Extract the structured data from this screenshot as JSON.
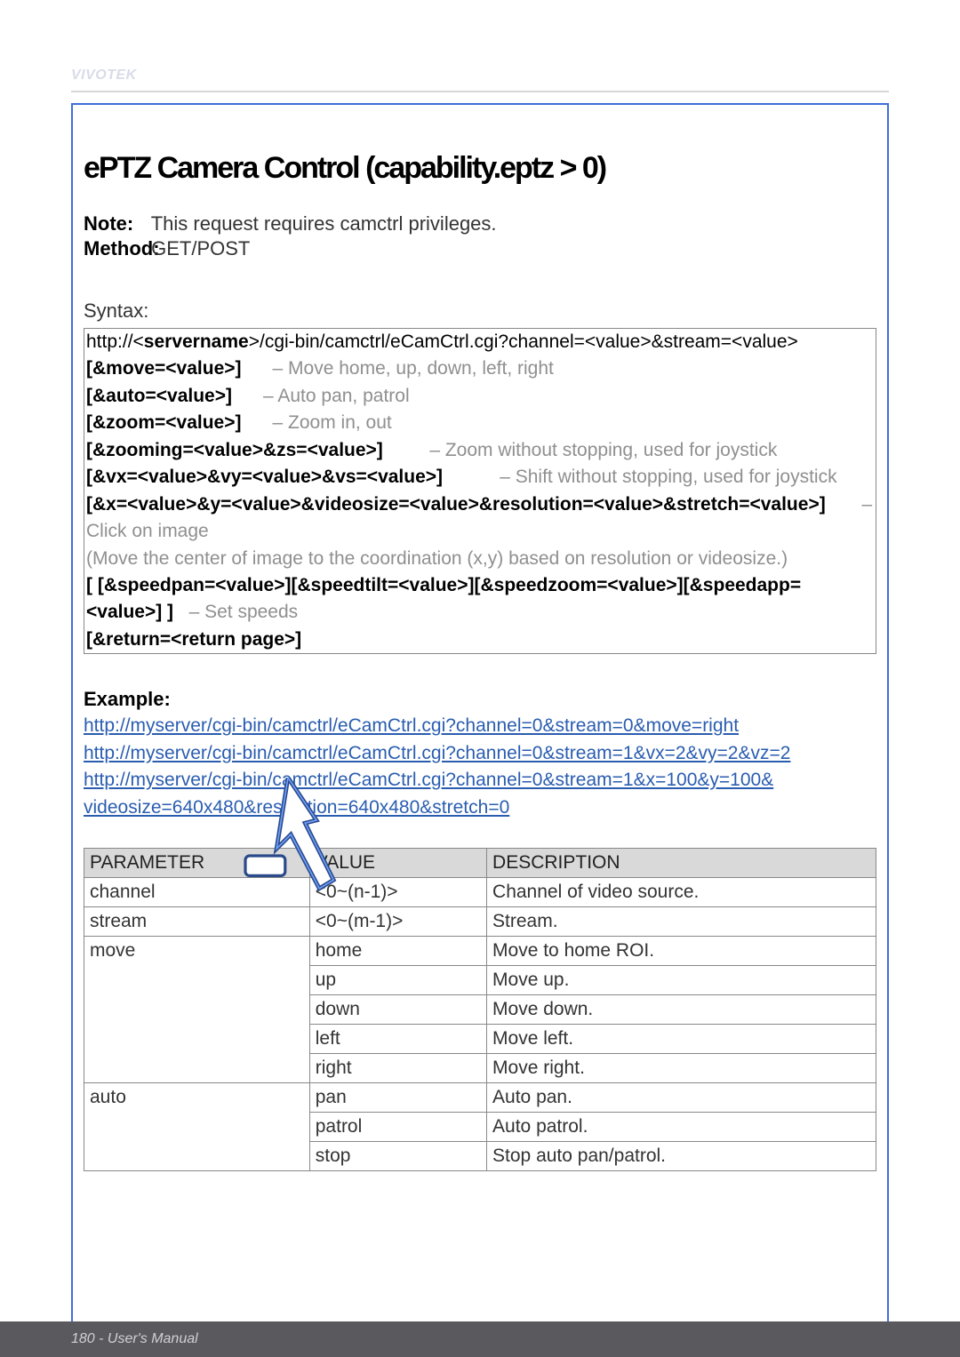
{
  "header": {
    "brand": "VIVOTEK"
  },
  "section": {
    "title": "ePTZ Camera Control (capability.eptz > 0)",
    "note_label": "Note:",
    "note_text": "This request requires camctrl privileges.",
    "method_label": "Method:",
    "method_text": "GET/POST"
  },
  "syntax": {
    "label": "Syntax:",
    "line_url_prefix": "http://<",
    "line_url_server": "servername",
    "line_url_rest": ">/cgi-bin/camctrl/eCamCtrl.cgi?channel=<value>&stream=<value>",
    "move_opt": "[&move=<value>]",
    "move_desc": "– Move home, up, down, left, right",
    "auto_opt": "[&auto=<value>]",
    "auto_desc": "– Auto pan, patrol",
    "zoom_opt": "[&zoom=<value>]",
    "zoom_desc": "– Zoom in, out",
    "zooming_opt": "[&zooming=<value>&zs=<value>]",
    "zooming_desc": "– Zoom without stopping, used for joystick",
    "vxvyvs_opt": "[&vx=<value>&vy=<value>&vs=<value>]",
    "vxvyvs_desc": "– Shift without stopping, used for joystick",
    "xy_opt": "[&x=<value>&y=<value>&videosize=<value>&resolution=<value>&stretch=<value>]",
    "xy_desc": "– Click on image",
    "xy_note": "(Move the center of image to the coordination (x,y) based on resolution or videosize.)",
    "speed_opt": "[ [&speedpan=<value>][&speedtilt=<value>][&speedzoom=<value>][&speedapp=<",
    "speed_value": "value",
    "speed_rest": ">] ]",
    "speed_desc": "– Set speeds",
    "return_opt": "[&return=<return page>]"
  },
  "example": {
    "label": "Example:",
    "line1": "http://myserver/cgi-bin/camctrl/eCamCtrl.cgi?channel=0&stream=0&move=right",
    "line2": "http://myserver/cgi-bin/camctrl/eCamCtrl.cgi?channel=0&stream=1&vx=2&vy=2&vz=2",
    "line3a": "http://myserver/cgi-bin/camctrl/eCamCtrl.cgi?channel=0&stream=1&x=100&y=100&",
    "line3b": "videosize=640x480&resolution=640x480&stretch=0"
  },
  "table": {
    "headers": [
      "PARAMETER",
      "VALUE",
      "DESCRIPTION"
    ],
    "rows": [
      {
        "param": "channel",
        "value": "<0~(n-1)>",
        "desc": "Channel of video source."
      },
      {
        "param": "stream",
        "value": "<0~(m-1)>",
        "desc": "Stream."
      },
      {
        "param": "move",
        "value": "home",
        "desc": "Move to home ROI."
      },
      {
        "param": "",
        "value": "up",
        "desc": "Move up."
      },
      {
        "param": "",
        "value": "down",
        "desc": "Move down."
      },
      {
        "param": "",
        "value": "left",
        "desc": "Move left."
      },
      {
        "param": "",
        "value": "right",
        "desc": "Move right."
      },
      {
        "param": "auto",
        "value": "pan",
        "desc": "Auto pan."
      },
      {
        "param": "",
        "value": "patrol",
        "desc": "Auto patrol."
      },
      {
        "param": "",
        "value": "stop",
        "desc": "Stop auto pan/patrol."
      }
    ]
  },
  "footer": {
    "text": "180 - User's Manual"
  }
}
